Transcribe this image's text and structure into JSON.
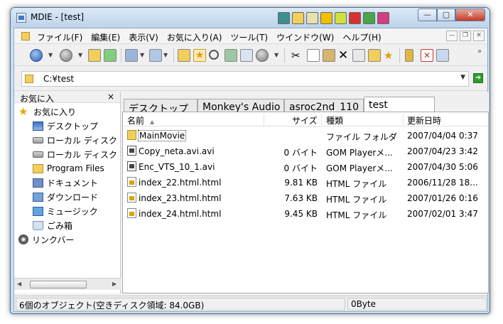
{
  "window": {
    "title": "MDIE - [test]"
  },
  "colors": {
    "title_bg": "#c9dff2",
    "folder": "#f2cf5c",
    "accent": "#2d63b5",
    "close": "#c4392a"
  },
  "menu": {
    "items": [
      "ファイル(F)",
      "編集(E)",
      "表示(V)",
      "お気に入り(A)",
      "ツール(T)",
      "ウインドウ(W)",
      "ヘルプ(H)"
    ]
  },
  "toolbar": {
    "icons": [
      "back-icon",
      "forward-icon",
      "up-icon",
      "refresh-icon",
      "view-icon",
      "sort-icon",
      "folder-icon",
      "favorites-icon",
      "search-icon",
      "thumbnail-icon",
      "window-icon",
      "network-icon",
      "cut-icon",
      "copy-icon",
      "paste-icon",
      "delete-icon",
      "properties-icon",
      "rename-icon",
      "new-folder-icon",
      "lock-icon",
      "close-icon",
      "tile-icon"
    ]
  },
  "address": {
    "path": "C:¥test"
  },
  "favorites": {
    "title": "お気に入",
    "close_glyph": "×",
    "items": [
      {
        "label": "お気に入り",
        "icon": "star-icon"
      },
      {
        "label": "デスクトップ",
        "icon": "desktop-icon"
      },
      {
        "label": "ローカル ディスク",
        "icon": "disk-icon"
      },
      {
        "label": "ローカル ディスク",
        "icon": "disk-icon"
      },
      {
        "label": "Program Files",
        "icon": "folder-icon"
      },
      {
        "label": "ドキュメント",
        "icon": "documents-icon"
      },
      {
        "label": "ダウンロード",
        "icon": "downloads-icon"
      },
      {
        "label": "ミュージック",
        "icon": "music-icon"
      },
      {
        "label": "ごみ箱",
        "icon": "trash-icon"
      },
      {
        "label": "リンクバー",
        "icon": "links-icon"
      }
    ]
  },
  "tabs": [
    {
      "label": "デスクトップ",
      "active": false
    },
    {
      "label": "Monkey's Audio",
      "active": false
    },
    {
      "label": "asroc2nd_110",
      "active": false
    },
    {
      "label": "test",
      "active": true
    }
  ],
  "filelist": {
    "columns": [
      "名前",
      "サイズ",
      "種類",
      "更新日時"
    ],
    "rows": [
      {
        "name": "MainMovie",
        "size": "",
        "type": "ファイル フォルダ",
        "date": "2007/04/04 0:37",
        "icon": "folder"
      },
      {
        "name": "Copy_neta.avi.avi",
        "size": "0 バイト",
        "type": "GOM Playerメ...",
        "date": "2007/04/23 3:42",
        "icon": "avi"
      },
      {
        "name": "Enc_VTS_10_1.avi",
        "size": "0 バイト",
        "type": "GOM Playerメ...",
        "date": "2007/04/30 5:06",
        "icon": "avi"
      },
      {
        "name": "index_22.html.html",
        "size": "9.81 KB",
        "type": "HTML ファイル",
        "date": "2006/11/28 18...",
        "icon": "html"
      },
      {
        "name": "index_23.html.html",
        "size": "7.63 KB",
        "type": "HTML ファイル",
        "date": "2007/01/26 0:16",
        "icon": "html"
      },
      {
        "name": "index_24.html.html",
        "size": "9.45 KB",
        "type": "HTML ファイル",
        "date": "2007/02/01 3:47",
        "icon": "html"
      }
    ]
  },
  "status": {
    "objects": "6個のオブジェクト(空きディスク領域: 84.0GB)",
    "size": "0Byte"
  }
}
